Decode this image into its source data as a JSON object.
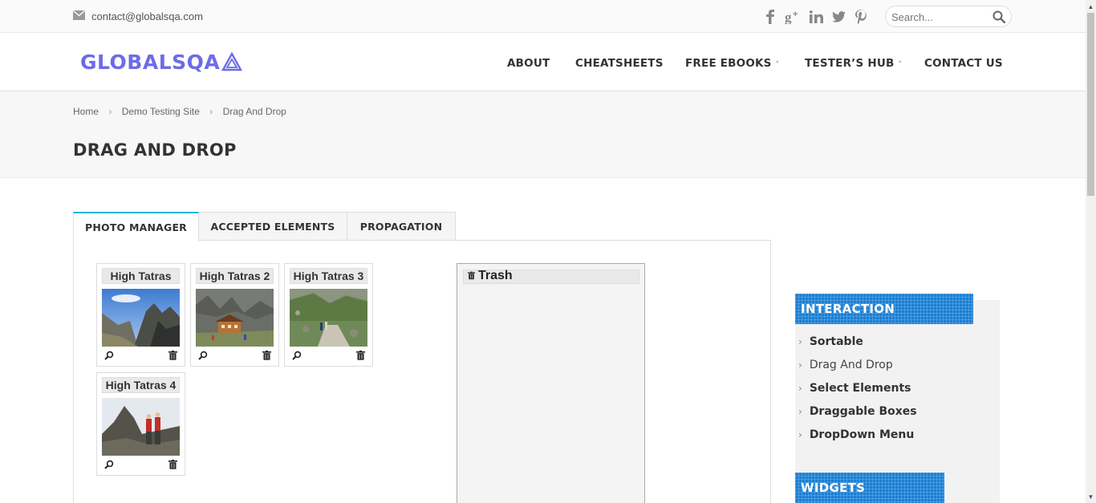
{
  "topbar": {
    "email": "contact@globalsqa.com",
    "social_icons": [
      "facebook-icon",
      "google-plus-icon",
      "linkedin-icon",
      "twitter-icon",
      "pinterest-icon"
    ],
    "search_placeholder": "Search..."
  },
  "header": {
    "logo_text": "GLOBALSQA",
    "nav": [
      {
        "label": "ABOUT",
        "has_dropdown": false
      },
      {
        "label": "CHEATSHEETS",
        "has_dropdown": false
      },
      {
        "label": "FREE EBOOKS",
        "has_dropdown": true
      },
      {
        "label": "TESTER’S HUB",
        "has_dropdown": true
      },
      {
        "label": "CONTACT US",
        "has_dropdown": false
      }
    ],
    "caret": "˅"
  },
  "breadcrumb": {
    "items": [
      "Home",
      "Demo Testing Site",
      "Drag And Drop"
    ],
    "separator": "›"
  },
  "page_title": "DRAG AND DROP",
  "tabs": [
    {
      "label": "PHOTO MANAGER",
      "active": true
    },
    {
      "label": "ACCEPTED ELEMENTS",
      "active": false
    },
    {
      "label": "PROPAGATION",
      "active": false
    }
  ],
  "gallery": [
    {
      "title": "High Tatras"
    },
    {
      "title": "High Tatras 2"
    },
    {
      "title": "High Tatras 3"
    },
    {
      "title": "High Tatras 4"
    }
  ],
  "trash": {
    "label": "Trash"
  },
  "sidebar": {
    "interaction_title": "INTERACTION",
    "links": [
      {
        "label": "Sortable",
        "current": false
      },
      {
        "label": "Drag And Drop",
        "current": true
      },
      {
        "label": "Select Elements",
        "current": false
      },
      {
        "label": "Draggable Boxes",
        "current": false
      },
      {
        "label": "DropDown Menu",
        "current": false
      }
    ],
    "widgets_title": "WIDGETS",
    "chevron": "›"
  },
  "colors": {
    "logo": "#6c6ce8",
    "tab_accent": "#26b7d6",
    "widget_blue": "#1a7fd4"
  }
}
